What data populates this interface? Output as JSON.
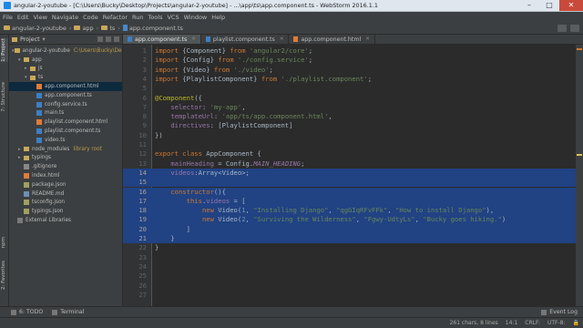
{
  "window": {
    "title": "angular-2-youtube - [C:\\Users\\Bucky\\Desktop\\Projects\\angular-2-youtube] - ...\\app\\ts\\app.component.ts - WebStorm 2016.1.1",
    "controls": [
      "–",
      "□",
      "✕"
    ]
  },
  "menu": [
    "File",
    "Edit",
    "View",
    "Navigate",
    "Code",
    "Refactor",
    "Run",
    "Tools",
    "VCS",
    "Window",
    "Help"
  ],
  "breadcrumbs": [
    "angular-2-youtube",
    "app",
    "ts",
    "app.component.ts"
  ],
  "sidebar_tabs": [
    "1: Project",
    "7: Structure",
    "npm",
    "2: Favorites"
  ],
  "project_panel": {
    "header": "Project",
    "tree": [
      {
        "label": "angular-2-youtube",
        "extra": "C:\\Users\\Bucky\\Deskt",
        "indent": 0,
        "icon": "folder",
        "arrow": "▾"
      },
      {
        "label": "app",
        "extra": "",
        "indent": 1,
        "icon": "folder",
        "arrow": "▾"
      },
      {
        "label": "js",
        "extra": "",
        "indent": 2,
        "icon": "folder",
        "arrow": "▸"
      },
      {
        "label": "ts",
        "extra": "",
        "indent": 2,
        "icon": "folder",
        "arrow": "▾"
      },
      {
        "label": "app.component.html",
        "extra": "",
        "indent": 3,
        "icon": "html",
        "arrow": "",
        "selected": true
      },
      {
        "label": "app.component.ts",
        "extra": "",
        "indent": 3,
        "icon": "ts",
        "arrow": ""
      },
      {
        "label": "config.service.ts",
        "extra": "",
        "indent": 3,
        "icon": "ts",
        "arrow": ""
      },
      {
        "label": "main.ts",
        "extra": "",
        "indent": 3,
        "icon": "ts",
        "arrow": ""
      },
      {
        "label": "playlist.component.html",
        "extra": "",
        "indent": 3,
        "icon": "html",
        "arrow": ""
      },
      {
        "label": "playlist.component.ts",
        "extra": "",
        "indent": 3,
        "icon": "ts",
        "arrow": ""
      },
      {
        "label": "video.ts",
        "extra": "",
        "indent": 3,
        "icon": "ts",
        "arrow": ""
      },
      {
        "label": "node_modules",
        "extra": "library root",
        "indent": 1,
        "icon": "folder",
        "arrow": "▸"
      },
      {
        "label": "typings",
        "extra": "",
        "indent": 1,
        "icon": "folder",
        "arrow": "▸"
      },
      {
        "label": ".gitignore",
        "extra": "",
        "indent": 1,
        "icon": "git",
        "arrow": ""
      },
      {
        "label": "index.html",
        "extra": "",
        "indent": 1,
        "icon": "html",
        "arrow": ""
      },
      {
        "label": "package.json",
        "extra": "",
        "indent": 1,
        "icon": "json",
        "arrow": ""
      },
      {
        "label": "README.md",
        "extra": "",
        "indent": 1,
        "icon": "md",
        "arrow": ""
      },
      {
        "label": "tsconfig.json",
        "extra": "",
        "indent": 1,
        "icon": "json",
        "arrow": ""
      },
      {
        "label": "typings.json",
        "extra": "",
        "indent": 1,
        "icon": "json",
        "arrow": ""
      },
      {
        "label": "External Libraries",
        "extra": "",
        "indent": 0,
        "icon": "lib",
        "arrow": ""
      }
    ]
  },
  "editor_tabs": [
    {
      "label": "app.component.ts",
      "icon": "ts",
      "active": true
    },
    {
      "label": "playlist.component.ts",
      "icon": "ts",
      "active": false
    },
    {
      "label": "app.component.html",
      "icon": "html",
      "active": false
    }
  ],
  "code_lines": [
    {
      "n": "1",
      "sel": false,
      "tokens": [
        [
          "kw",
          "import "
        ],
        [
          "plain",
          "{Component} "
        ],
        [
          "kw",
          "from "
        ],
        [
          "str",
          "'angular2/core'"
        ],
        [
          "plain",
          ";"
        ]
      ]
    },
    {
      "n": "2",
      "sel": false,
      "tokens": [
        [
          "kw",
          "import "
        ],
        [
          "plain",
          "{Config} "
        ],
        [
          "kw",
          "from "
        ],
        [
          "str",
          "'./config.service'"
        ],
        [
          "plain",
          ";"
        ]
      ]
    },
    {
      "n": "3",
      "sel": false,
      "tokens": [
        [
          "kw",
          "import "
        ],
        [
          "plain",
          "{Video} "
        ],
        [
          "kw",
          "from "
        ],
        [
          "str",
          "'./video'"
        ],
        [
          "plain",
          ";"
        ]
      ]
    },
    {
      "n": "4",
      "sel": false,
      "tokens": [
        [
          "kw",
          "import "
        ],
        [
          "plain",
          "{PlaylistComponent} "
        ],
        [
          "kw",
          "from "
        ],
        [
          "str",
          "'./playlist.component'"
        ],
        [
          "plain",
          ";"
        ]
      ]
    },
    {
      "n": "5",
      "sel": false,
      "tokens": []
    },
    {
      "n": "6",
      "sel": false,
      "tokens": [
        [
          "anno",
          "@Component"
        ],
        [
          "plain",
          "({"
        ]
      ]
    },
    {
      "n": "7",
      "sel": false,
      "tokens": [
        [
          "plain",
          "    "
        ],
        [
          "fld",
          "selector"
        ],
        [
          "plain",
          ": "
        ],
        [
          "str",
          "'my-app'"
        ],
        [
          "plain",
          ","
        ]
      ]
    },
    {
      "n": "8",
      "sel": false,
      "tokens": [
        [
          "plain",
          "    "
        ],
        [
          "fld",
          "templateUrl"
        ],
        [
          "plain",
          ": "
        ],
        [
          "str",
          "'app/ts/app.component.html'"
        ],
        [
          "plain",
          ","
        ]
      ]
    },
    {
      "n": "9",
      "sel": false,
      "tokens": [
        [
          "plain",
          "    "
        ],
        [
          "fld",
          "directives"
        ],
        [
          "plain",
          ": [PlaylistComponent]"
        ]
      ]
    },
    {
      "n": "10",
      "sel": false,
      "tokens": [
        [
          "plain",
          "})"
        ]
      ]
    },
    {
      "n": "11",
      "sel": false,
      "tokens": []
    },
    {
      "n": "12",
      "sel": false,
      "tokens": [
        [
          "kw",
          "export class "
        ],
        [
          "plain",
          "AppComponent {"
        ]
      ]
    },
    {
      "n": "13",
      "sel": false,
      "tokens": [
        [
          "plain",
          "    "
        ],
        [
          "fld",
          "mainHeading"
        ],
        [
          "plain",
          " = Config."
        ],
        [
          "ital",
          "MAIN_HEADING"
        ],
        [
          "plain",
          ";"
        ]
      ]
    },
    {
      "n": "14",
      "sel": true,
      "tokens": [
        [
          "plain",
          "    "
        ],
        [
          "fld",
          "videos"
        ],
        [
          "plain",
          ":Array<Video>;"
        ]
      ]
    },
    {
      "n": "15",
      "sel": true,
      "tokens": []
    },
    {
      "n": "16",
      "sel": true,
      "tokens": [
        [
          "plain",
          "    "
        ],
        [
          "kw",
          "constructor"
        ],
        [
          "plain",
          "(){"
        ]
      ]
    },
    {
      "n": "17",
      "sel": true,
      "tokens": [
        [
          "plain",
          "        "
        ],
        [
          "kw",
          "this"
        ],
        [
          "plain",
          "."
        ],
        [
          "fld",
          "videos"
        ],
        [
          "plain",
          " = ["
        ]
      ]
    },
    {
      "n": "18",
      "sel": true,
      "tokens": [
        [
          "plain",
          "            "
        ],
        [
          "kw",
          "new "
        ],
        [
          "plain",
          "Video("
        ],
        [
          "num-lit",
          "1"
        ],
        [
          "plain",
          ", "
        ],
        [
          "str",
          "\"Installing Django\""
        ],
        [
          "plain",
          ", "
        ],
        [
          "str",
          "\"qgGIqRFvFFk\""
        ],
        [
          "plain",
          ", "
        ],
        [
          "str",
          "\"How to install Django\""
        ],
        [
          "plain",
          "),"
        ]
      ]
    },
    {
      "n": "19",
      "sel": true,
      "tokens": [
        [
          "plain",
          "            "
        ],
        [
          "kw",
          "new "
        ],
        [
          "plain",
          "Video("
        ],
        [
          "num-lit",
          "2"
        ],
        [
          "plain",
          ", "
        ],
        [
          "str",
          "\"Surviving the Wilderness\""
        ],
        [
          "plain",
          ", "
        ],
        [
          "str",
          "\"Fgwy-UdtyLs\""
        ],
        [
          "plain",
          ", "
        ],
        [
          "str",
          "\"Bucky goes hiking.\""
        ],
        [
          "plain",
          ")"
        ]
      ]
    },
    {
      "n": "20",
      "sel": true,
      "tokens": [
        [
          "plain",
          "        ]"
        ]
      ]
    },
    {
      "n": "21",
      "sel": true,
      "tokens": [
        [
          "plain",
          "    }"
        ]
      ]
    },
    {
      "n": "22",
      "sel": false,
      "tokens": [
        [
          "plain",
          "}"
        ]
      ]
    },
    {
      "n": "23",
      "sel": false,
      "tokens": []
    },
    {
      "n": "24",
      "sel": false,
      "tokens": []
    },
    {
      "n": "25",
      "sel": false,
      "tokens": []
    },
    {
      "n": "26",
      "sel": false,
      "tokens": []
    },
    {
      "n": "27",
      "sel": false,
      "tokens": []
    }
  ],
  "bottom_tools": [
    "6: TODO",
    "Terminal"
  ],
  "event_log": "Event Log",
  "status": {
    "selection": "261 chars, 8 lines",
    "position": "14:1",
    "line_sep": "CRLF:",
    "encoding": "UTF-8:"
  }
}
